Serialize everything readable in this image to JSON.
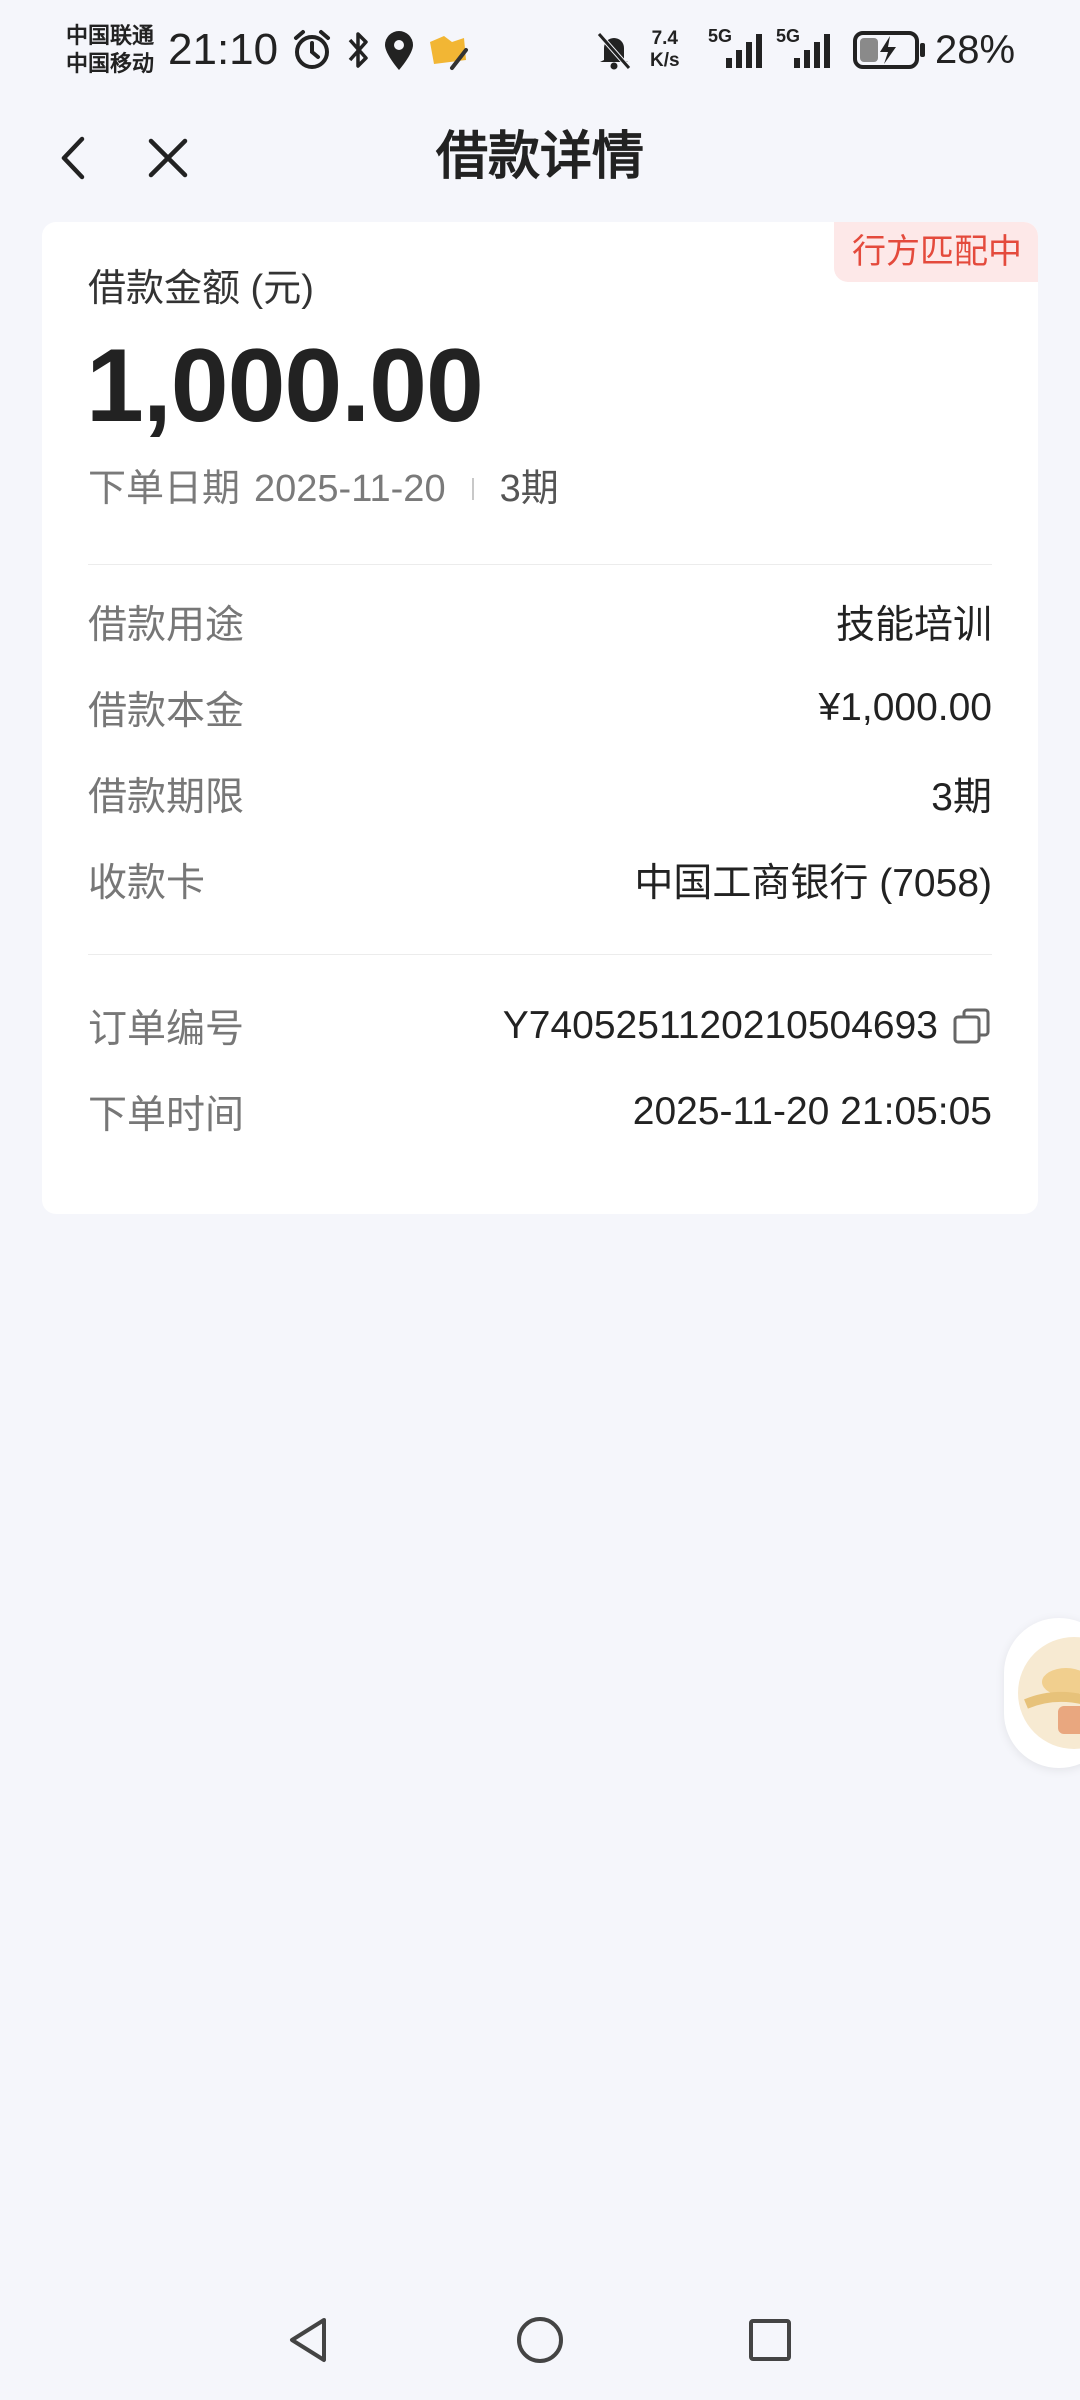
{
  "status_bar": {
    "carrier_1": "中国联通",
    "carrier_2": "中国移动",
    "time": "21:10",
    "net_speed_value": "7.4",
    "net_speed_unit": "K/s",
    "signal_1_label": "5G",
    "signal_2_label": "5G",
    "battery": "28%",
    "icons": [
      "alarm-icon",
      "bluetooth-icon",
      "location-icon",
      "app-notification-icon",
      "mute-icon",
      "signal-icon",
      "signal-icon",
      "battery-charging-icon"
    ]
  },
  "nav": {
    "title": "借款详情",
    "back_icon": "chevron-left-icon",
    "close_icon": "close-icon"
  },
  "card": {
    "status_badge": "行方匹配中",
    "amount_label": "借款金额 (元)",
    "amount": "1,000.00",
    "order_date_label": "下单日期",
    "order_date": "2025-11-20",
    "periods": "3期",
    "details": [
      {
        "label": "借款用途",
        "value": "技能培训"
      },
      {
        "label": "借款本金",
        "value": "¥1,000.00"
      },
      {
        "label": "借款期限",
        "value": "3期"
      },
      {
        "label": "收款卡",
        "value": "中国工商银行 (7058)"
      }
    ],
    "order_info": [
      {
        "label": "订单编号",
        "value": "Y7405251120210504693"
      },
      {
        "label": "下单时间",
        "value": "2025-11-20 21:05:05"
      }
    ]
  },
  "colors": {
    "background": "#f5f6fb",
    "card": "#ffffff",
    "badge_bg": "#fde8e8",
    "badge_text": "#e44a3c"
  }
}
